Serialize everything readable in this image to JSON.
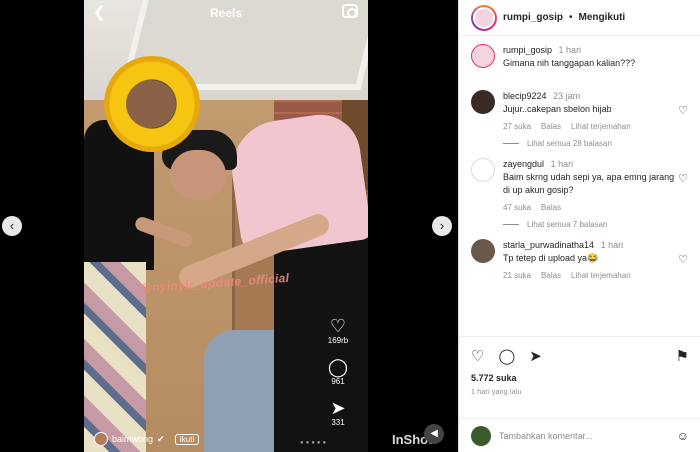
{
  "video": {
    "title": "Reels",
    "watermark": "@nyinyir_update_official",
    "likes": "169rb",
    "comments": "961",
    "shares": "331",
    "username": "baimwong",
    "follow_label": "Ikuti",
    "brand": "InShot"
  },
  "panel": {
    "header": {
      "username": "rumpi_gosip",
      "separator": "•",
      "follow_label": "Mengikuti"
    },
    "caption": {
      "username": "rumpi_gosip",
      "time": "1 hari",
      "text": "Gimana nih tanggapan kalian???"
    },
    "comments": [
      {
        "username": "blecip9224",
        "time": "23 jam",
        "text": "Jujur..cakepan sbelon hijab",
        "likes": "27 suka",
        "reply": "Balas",
        "translate": "Lihat terjemahan",
        "replies": "Lihat semua 28 balasan"
      },
      {
        "username": "zayengdul",
        "time": "1 hari",
        "text": "Baim skrng udah sepi ya, apa emng jarang di up akun gosip?",
        "likes": "47 suka",
        "reply": "Balas",
        "translate": "",
        "replies": "Lihat semua 7 balasan"
      },
      {
        "username": "starla_purwadinatha14",
        "time": "1 hari",
        "text": "Tp tetep di upload ya😂",
        "likes": "21 suka",
        "reply": "Balas",
        "translate": "Lihat terjemahan",
        "replies": ""
      }
    ],
    "like_count": "5.772 suka",
    "posted": "1 hari yang lalu",
    "add_comment_placeholder": "Tambahkan komentar..."
  },
  "colors": {
    "accent": "#262626",
    "muted": "#8e8e8e",
    "sunflower": "#f6c511"
  }
}
